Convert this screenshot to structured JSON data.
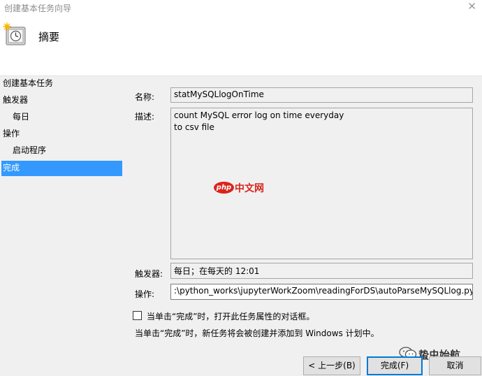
{
  "window": {
    "title": "创建基本任务向导",
    "close_glyph": "✕"
  },
  "header": {
    "icon": "task-clock-icon",
    "heading": "摘要"
  },
  "steps": [
    {
      "label": "创建基本任务",
      "level": 0,
      "active": false
    },
    {
      "label": "触发器",
      "level": 0,
      "active": false
    },
    {
      "label": "每日",
      "level": 1,
      "active": false
    },
    {
      "label": "操作",
      "level": 0,
      "active": false
    },
    {
      "label": "启动程序",
      "level": 1,
      "active": false
    },
    {
      "label": "完成",
      "level": 0,
      "active": true
    }
  ],
  "form": {
    "name_label": "名称:",
    "name_value": "statMySQLlogOnTime",
    "desc_label": "描述:",
    "desc_value": "count MySQL error log on time everyday\nto csv file",
    "trigger_label": "触发器:",
    "trigger_value": "每日；在每天的 12:01",
    "action_label": "操作:",
    "action_value": ":\\python_works\\jupyterWorkZoom\\readingForDS\\autoParseMySQLlog.py"
  },
  "options": {
    "open_properties_label": "当单击“完成”时，打开此任务属性的对话框。",
    "open_properties_checked": false,
    "info_text": "当单击“完成”时，新任务将会被创建并添加到 Windows 计划中。"
  },
  "buttons": {
    "back": "< 上一步(B)",
    "finish": "完成(F)",
    "cancel": "取消"
  },
  "watermarks": {
    "php_badge": "php",
    "php_site": "中文网",
    "author": "蛰虫始航"
  },
  "colors": {
    "selection": "#3399ff",
    "brand_red": "#d9251d"
  }
}
